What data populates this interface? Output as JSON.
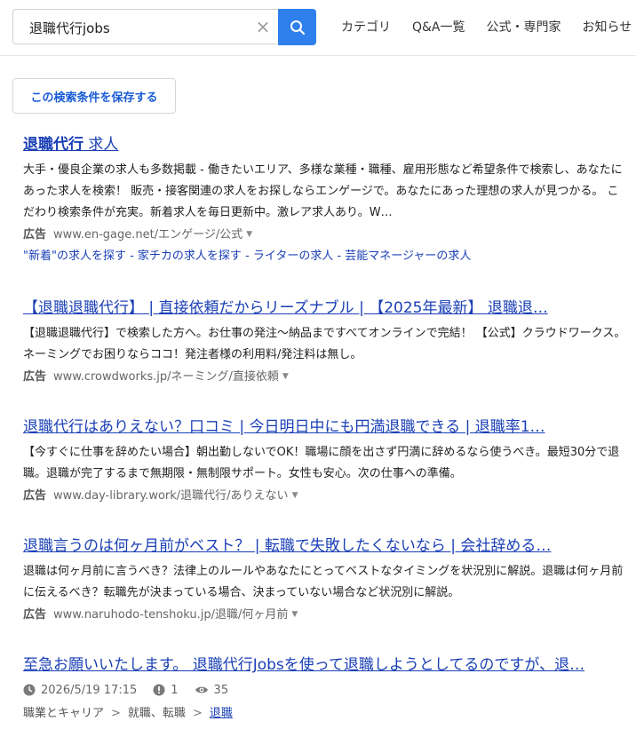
{
  "search": {
    "query": "退職代行jobs",
    "clear_glyph": "×"
  },
  "nav": [
    "カテゴリ",
    "Q&A一覧",
    "公式・専門家",
    "お知らせ"
  ],
  "save_button": "この検索条件を保存する",
  "results": [
    {
      "title_bold": "退職代行",
      "title_rest": " 求人",
      "desc": "大手・優良企業の求人も多数掲載 - 働きたいエリア、多様な業種・職種、雇用形態など希望条件で検索し、あなたにあった求人を検索！ 販売・接客関連の求人をお探しならエンゲージで。あなたにあった理想の求人が見つかる。 こだわり検索条件が充実。新着求人を毎日更新中。激レア求人あり。W…",
      "ad_label": "広告",
      "url": "www.en-gage.net/エンゲージ/公式",
      "sitelinks": "\"新着\"の求人を探す - 家チカの求人を探す - ライターの求人 - 芸能マネージャーの求人"
    },
    {
      "title": "【退職退職代行】 | 直接依頼だからリーズナブル | 【2025年最新】 退職退…",
      "desc": "【退職退職代行】で検索した方へ。お仕事の発注～納品まですべてオンラインで完結！ 【公式】クラウドワークス。ネーミングでお困りならココ！発注者様の利用料/発注料は無し。",
      "ad_label": "広告",
      "url": "www.crowdworks.jp/ネーミング/直接依頼"
    },
    {
      "title": "退職代行はありえない？口コミ | 今日明日中にも円満退職できる | 退職率1…",
      "desc": "【今すぐに仕事を辞めたい場合】朝出勤しないでOK！職場に顔を出さず円満に辞めるなら使うべき。最短30分で退職。退職が完了するまで無期限・無制限サポート。女性も安心。次の仕事への準備。",
      "ad_label": "広告",
      "url": "www.day-library.work/退職代行/ありえない"
    },
    {
      "title": "退職言うのは何ヶ月前がベスト？ | 転職で失敗したくないなら | 会社辞める…",
      "desc": "退職は何ヶ月前に言うべき？法律上のルールやあなたにとってベストなタイミングを状況別に解説。退職は何ヶ月前に伝えるべき？転職先が決まっている場合、決まっていない場合など状況別に解説。",
      "ad_label": "広告",
      "url": "www.naruhodo-tenshoku.jp/退職/何ヶ月前"
    },
    {
      "title": "至急お願いいたします。 退職代行Jobsを使って退職しようとしてるのですが、退…",
      "date": "2026/5/19 17:15",
      "answers": "1",
      "views": "35",
      "breadcrumb": [
        "職業とキャリア",
        "就職、転職",
        "退職"
      ],
      "crumb_sep": ">"
    }
  ],
  "colors": {
    "link": "#1a3fb6",
    "search_button": "#2f80ed"
  },
  "icons": [
    "clear-icon",
    "search-icon",
    "clock-icon",
    "answers-icon",
    "views-icon",
    "caret-down-icon"
  ]
}
